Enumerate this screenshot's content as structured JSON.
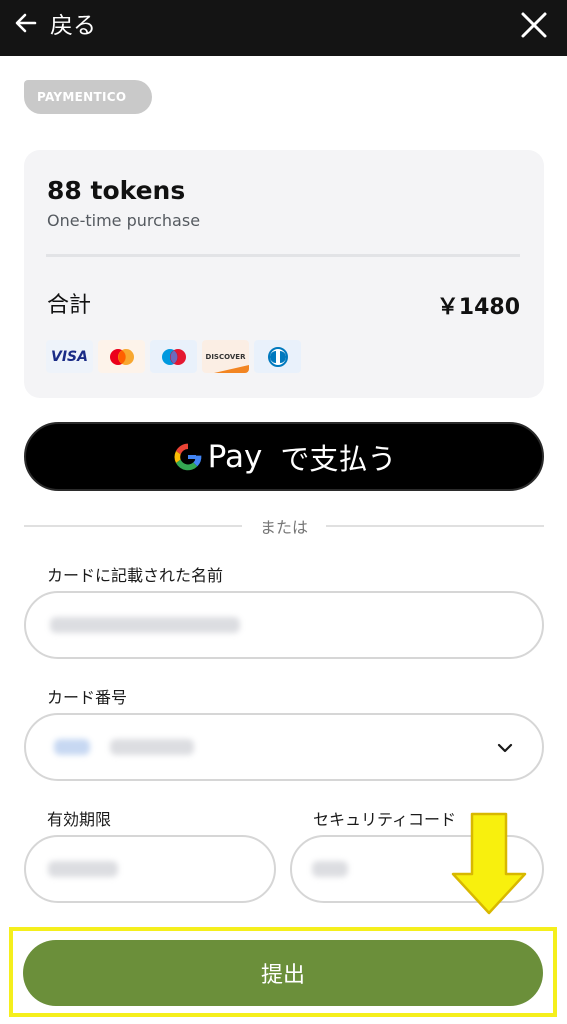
{
  "header": {
    "back_label": "戻る"
  },
  "brand": {
    "name": "PAYMENTICO"
  },
  "summary": {
    "product_name": "88 tokens",
    "product_sub": "One-time purchase",
    "total_label": "合計",
    "total_amount": "￥1480",
    "card_brands": [
      "VISA",
      "Mastercard",
      "Maestro",
      "DISCOVER",
      "Diners Club"
    ]
  },
  "gpay": {
    "pay_word": "Pay",
    "label": "で支払う"
  },
  "divider": {
    "or_text": "または"
  },
  "form": {
    "name_label": "カードに記載された名前",
    "card_label": "カード番号",
    "expiry_label": "有効期限",
    "cvc_label": "セキュリティコード"
  },
  "submit": {
    "label": "提出"
  },
  "colors": {
    "submit": "#6b8f3a",
    "highlight": "#f5ef1c",
    "header": "#141414"
  }
}
